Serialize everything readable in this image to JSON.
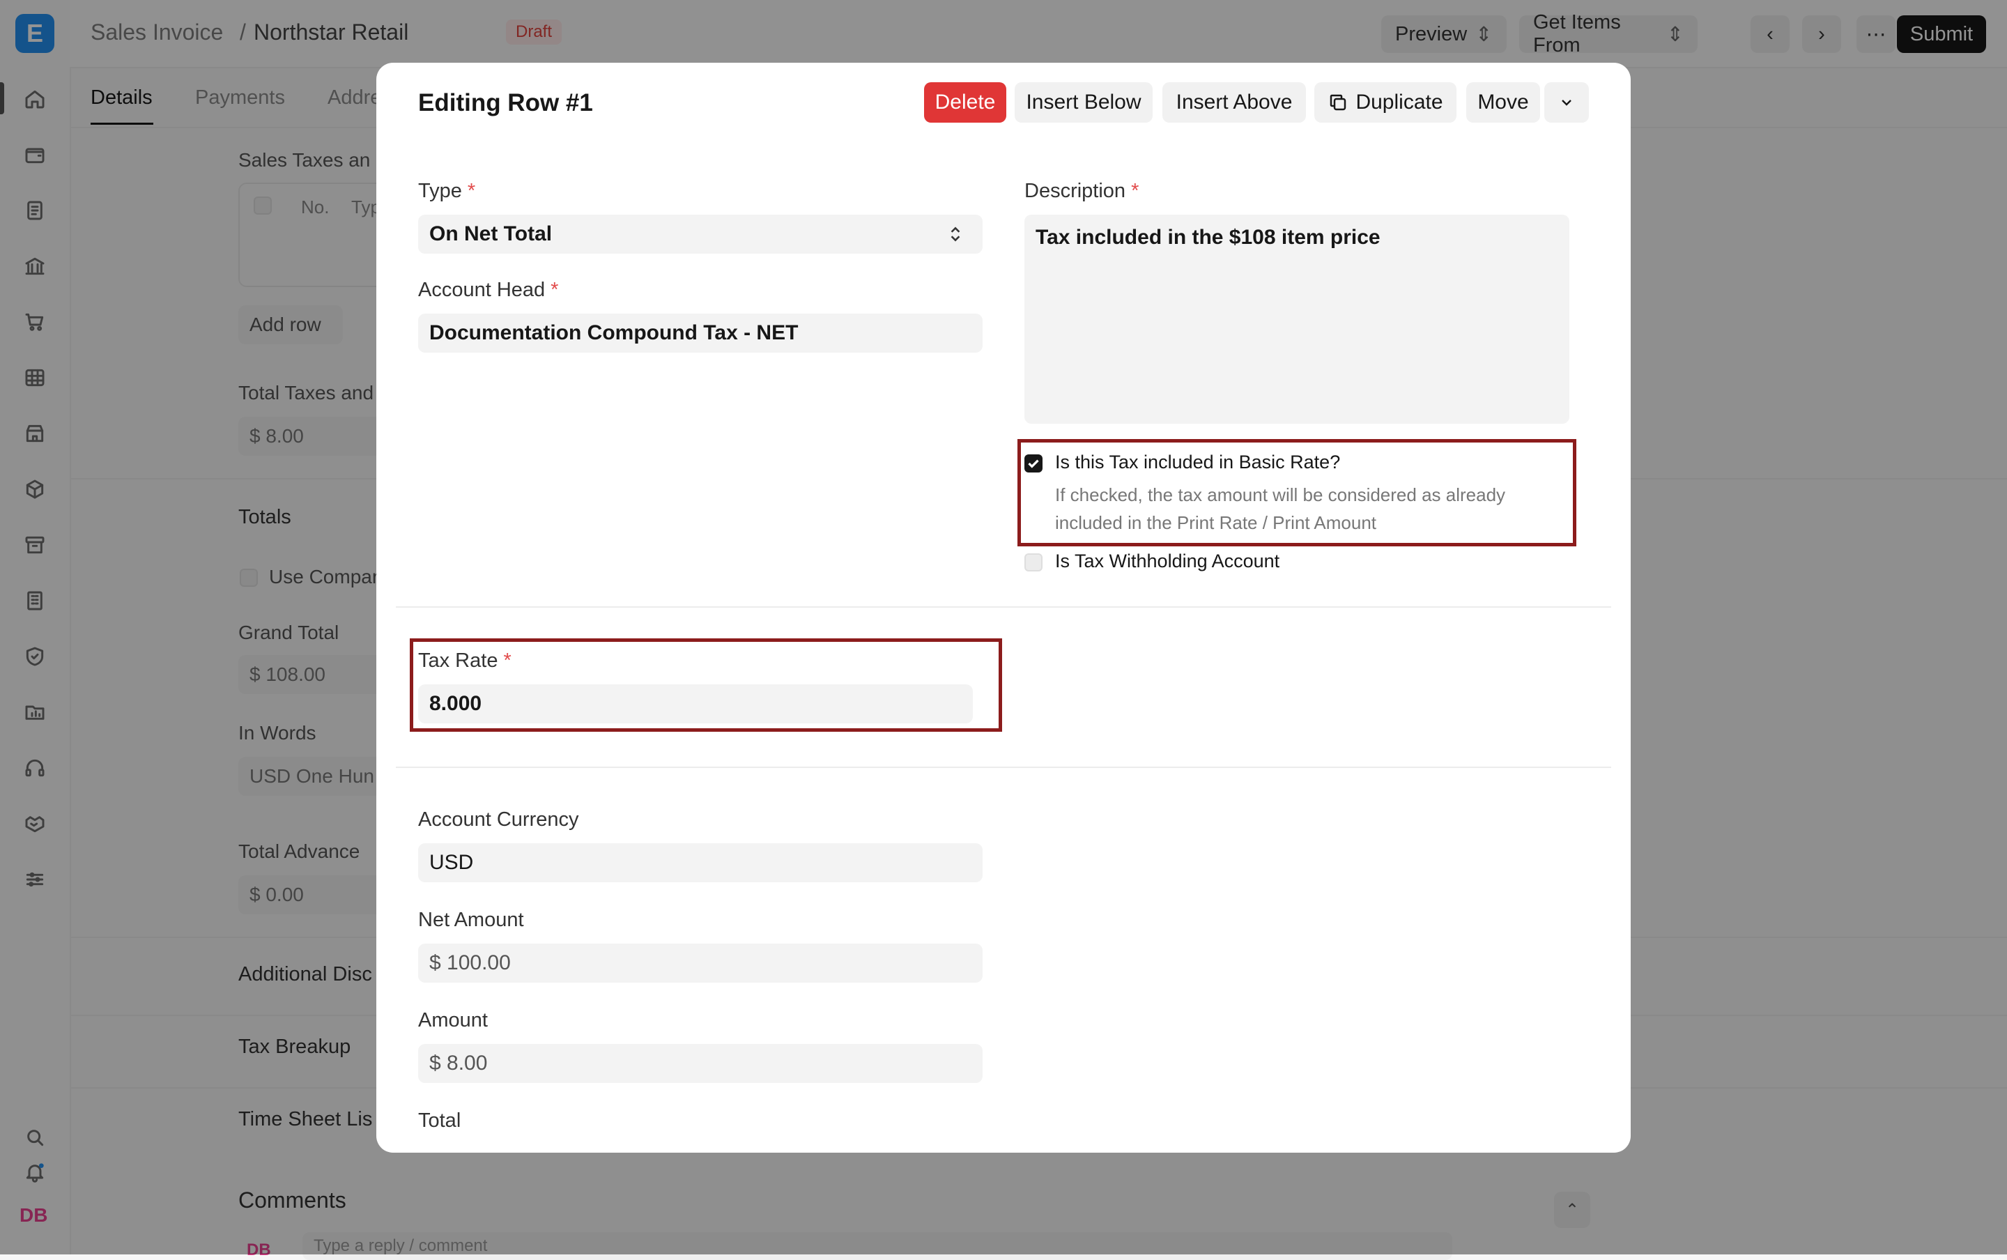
{
  "app": {
    "logo_letter": "E",
    "user_initials": "DB"
  },
  "breadcrumb": {
    "doctype": "Sales Invoice",
    "separator": "/",
    "record": "Northstar Retail",
    "status": "Draft"
  },
  "toolbar": {
    "preview_label": "Preview",
    "get_items_label": "Get Items From",
    "submit_label": "Submit"
  },
  "background_form": {
    "tabs": [
      {
        "label": "Details"
      },
      {
        "label": "Payments"
      },
      {
        "label": "Addre"
      }
    ],
    "sales_taxes_label": "Sales Taxes an",
    "table_col_no": "No.",
    "table_col_type": "Typ",
    "add_row_label": "Add row",
    "total_taxes_label": "Total Taxes and",
    "total_taxes_value": "$ 8.00",
    "totals_heading": "Totals",
    "use_company_label": "Use Compar",
    "grand_total_label": "Grand Total",
    "grand_total_value": "$ 108.00",
    "in_words_label": "In Words",
    "in_words_value": "USD One Hun",
    "total_advance_label": "Total Advance",
    "total_advance_value": "$ 0.00",
    "additional_disc_label": "Additional Disc",
    "tax_breakup_label": "Tax Breakup",
    "time_sheet_label": "Time Sheet Lis",
    "comments_heading": "Comments",
    "comment_avatar": "DB",
    "comment_placeholder": "Type a reply / comment"
  },
  "modal": {
    "title": "Editing Row #1",
    "buttons": {
      "delete": "Delete",
      "insert_below": "Insert Below",
      "insert_above": "Insert Above",
      "duplicate": "Duplicate",
      "move": "Move"
    },
    "fields": {
      "type_label": "Type",
      "type_value": "On Net Total",
      "account_head_label": "Account Head",
      "account_head_value": "Documentation Compound Tax - NET",
      "description_label": "Description",
      "description_value": "Tax included in the $108 item price",
      "included_label": "Is this Tax included in Basic Rate?",
      "included_help_1": "If checked, the tax amount will be considered as already",
      "included_help_2": "included in the Print Rate / Print Amount",
      "included_checked": true,
      "withholding_label": "Is Tax Withholding Account",
      "withholding_checked": false,
      "tax_rate_label": "Tax Rate",
      "tax_rate_value": "8.000",
      "account_currency_label": "Account Currency",
      "account_currency_value": "USD",
      "net_amount_label": "Net Amount",
      "net_amount_value": "$ 100.00",
      "amount_label": "Amount",
      "amount_value": "$ 8.00",
      "total_label": "Total"
    },
    "required_marker": "*"
  },
  "colors": {
    "highlight": "#8c1c1c",
    "danger": "#e03636",
    "logo": "#2490ef"
  }
}
